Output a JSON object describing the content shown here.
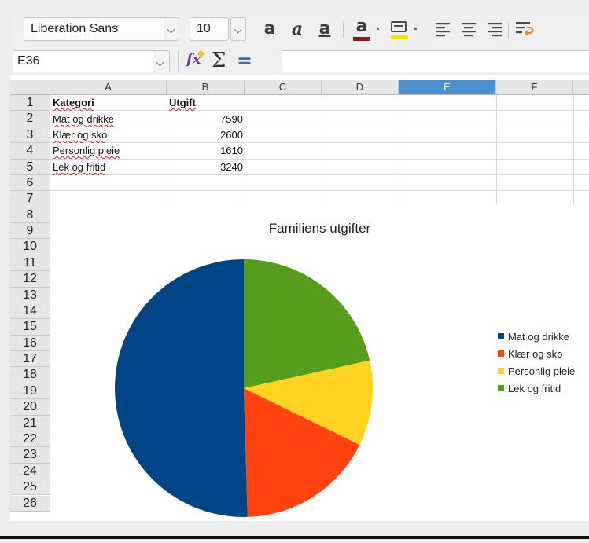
{
  "toolbar": {
    "font_name": "Liberation Sans",
    "font_size": "10",
    "icons": [
      "bold-icon",
      "italic-icon",
      "underline-icon",
      "font-color-icon",
      "highlight-icon",
      "align-left-icon",
      "align-center-icon",
      "align-right-icon",
      "wrap-text-icon"
    ],
    "font_color": "#8b1a1a",
    "highlight_color": "#f5e400"
  },
  "formula_bar": {
    "name_box": "E36",
    "function_wizard": "fx",
    "sum_symbol": "Σ",
    "equals_symbol": "=",
    "content": ""
  },
  "grid": {
    "columns": [
      "A",
      "B",
      "C",
      "D",
      "E",
      "F"
    ],
    "selected_column": "E",
    "rows": [
      "1",
      "2",
      "3",
      "4",
      "5",
      "6",
      "7",
      "8",
      "9",
      "10",
      "11",
      "12",
      "13",
      "14",
      "15",
      "16",
      "17",
      "18",
      "19",
      "20",
      "21",
      "22",
      "23",
      "24",
      "25",
      "26"
    ],
    "header": {
      "a": "Kategori",
      "b": "Utgift"
    },
    "data_rows": [
      {
        "a": "Mat og drikke",
        "b": "7590"
      },
      {
        "a": "Klær og sko",
        "b": "2600"
      },
      {
        "a": "Personlig pleie",
        "b": "1610"
      },
      {
        "a": "Lek og fritid",
        "b": "3240"
      }
    ]
  },
  "chart_data": {
    "type": "pie",
    "title": "Familiens utgifter",
    "categories": [
      "Mat og drikke",
      "Klær og sko",
      "Personlig pleie",
      "Lek og fritid"
    ],
    "values": [
      7590,
      2600,
      1610,
      3240
    ],
    "colors": [
      "#004586",
      "#ff420e",
      "#ffd320",
      "#579d1c"
    ],
    "legend_position": "right"
  }
}
